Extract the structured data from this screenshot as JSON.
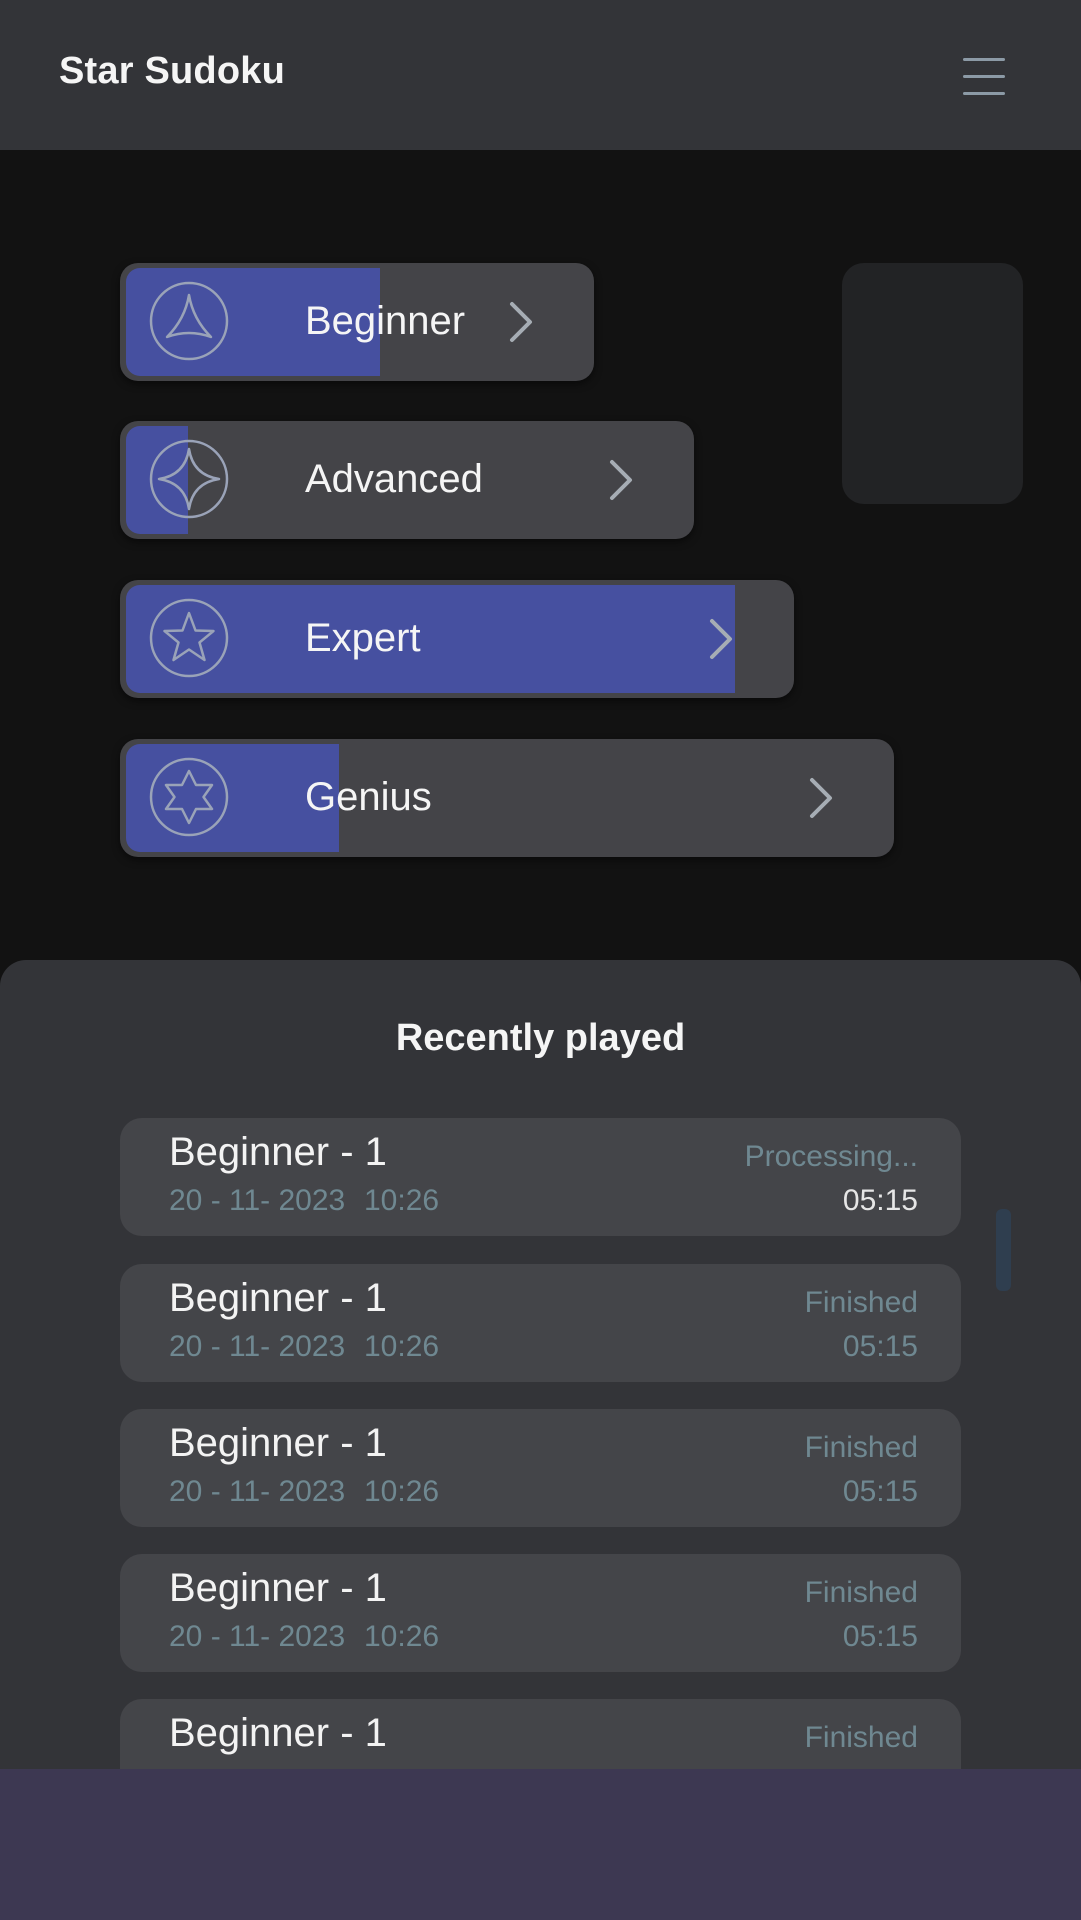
{
  "app": {
    "title": "Star Sudoku"
  },
  "header": {
    "menu_icon": "hamburger-menu-icon"
  },
  "levels": [
    {
      "label": "Beginner",
      "icon": "triangle-star-icon",
      "progress": 0.55
    },
    {
      "label": "Advanced",
      "icon": "four-point-star-icon",
      "progress": 0.11
    },
    {
      "label": "Expert",
      "icon": "five-point-star-icon",
      "progress": 0.92
    },
    {
      "label": "Genius",
      "icon": "six-point-star-icon",
      "progress": 0.28
    }
  ],
  "recent": {
    "title": "Recently played",
    "items": [
      {
        "name": "Beginner - 1",
        "date": "20 - 11- 2023",
        "time": "10:26",
        "status": "Processing...",
        "duration": "05:15"
      },
      {
        "name": "Beginner - 1",
        "date": "20 - 11- 2023",
        "time": "10:26",
        "status": "Finished",
        "duration": "05:15"
      },
      {
        "name": "Beginner - 1",
        "date": "20 - 11- 2023",
        "time": "10:26",
        "status": "Finished",
        "duration": "05:15"
      },
      {
        "name": "Beginner - 1",
        "date": "20 - 11- 2023",
        "time": "10:26",
        "status": "Finished",
        "duration": "05:15"
      },
      {
        "name": "Beginner - 1",
        "status": "Finished"
      }
    ]
  },
  "colors": {
    "accent": "#4650a0",
    "background": "#121212",
    "surface": "#333438",
    "card": "#444549",
    "muted_text": "#6f8891",
    "bottom_band": "#3d3852"
  }
}
